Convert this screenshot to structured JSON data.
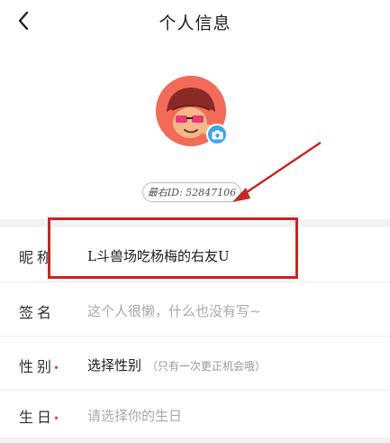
{
  "header": {
    "title": "个人信息",
    "back_icon": "chevron-left-icon"
  },
  "profile": {
    "avatar_icon": "cartoon-mushroom-avatar",
    "camera_icon": "camera-icon",
    "id_label": "最右ID: 52847106"
  },
  "form": {
    "nickname": {
      "label": "昵称",
      "value": "L斗兽场吃杨梅的右友U"
    },
    "signature": {
      "label": "签名",
      "placeholder": "这个人很懒，什么也没有写~"
    },
    "gender": {
      "label": "性别",
      "required_mark": "•",
      "value": "选择性别",
      "hint": "（只有一次更正机会哦）"
    },
    "birthday": {
      "label": "生日",
      "required_mark": "•",
      "placeholder": "请选择你的生日"
    }
  },
  "colors": {
    "annotation_red": "#c62828",
    "camera_blue": "#3fa6ea",
    "avatar_bg": "#f26b58"
  }
}
